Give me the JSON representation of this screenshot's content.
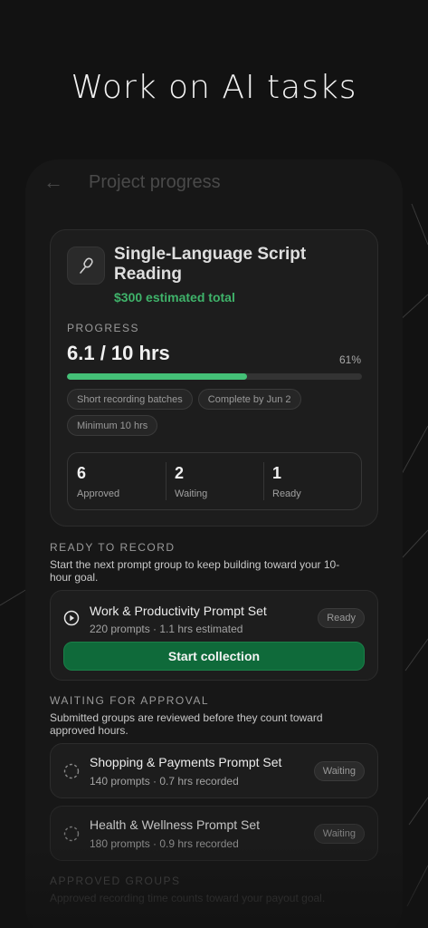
{
  "headline": "Work on AI tasks",
  "header": {
    "back_icon": "arrow-left-icon",
    "title": "Project progress"
  },
  "project": {
    "icon": "microphone-icon",
    "title": "Single-Language Script Reading",
    "estimated_total": "$300 estimated total",
    "progress_label": "PROGRESS",
    "progress_value": "6.1 / 10 hrs",
    "progress_percent": "61%",
    "progress_fraction": 0.61,
    "chips": [
      "Short recording batches",
      "Complete by Jun 2",
      "Minimum 10 hrs"
    ],
    "stats": [
      {
        "value": "6",
        "label": "Approved"
      },
      {
        "value": "2",
        "label": "Waiting"
      },
      {
        "value": "1",
        "label": "Ready"
      }
    ]
  },
  "ready": {
    "title": "READY TO RECORD",
    "description": "Start the next prompt group to keep building toward your 10-hour goal.",
    "task": {
      "icon": "play-circle-icon",
      "name": "Work & Productivity Prompt Set",
      "meta": "220 prompts · 1.1 hrs estimated",
      "badge": "Ready",
      "button": "Start collection"
    }
  },
  "waiting": {
    "title": "WAITING FOR APPROVAL",
    "description": "Submitted groups are reviewed before they count toward approved hours.",
    "tasks": [
      {
        "icon": "pending-circle-icon",
        "name": "Shopping & Payments Prompt Set",
        "meta": "140 prompts · 0.7 hrs recorded",
        "badge": "Waiting"
      },
      {
        "icon": "pending-circle-icon",
        "name": "Health & Wellness Prompt Set",
        "meta": "180 prompts · 0.9 hrs recorded",
        "badge": "Waiting"
      }
    ]
  },
  "approved": {
    "title": "APPROVED GROUPS",
    "description": "Approved recording time counts toward your payout goal."
  },
  "colors": {
    "accent_green": "#3fb36a",
    "button_green": "#0f6a3a",
    "background": "#121212",
    "card": "#1d1d1d"
  }
}
